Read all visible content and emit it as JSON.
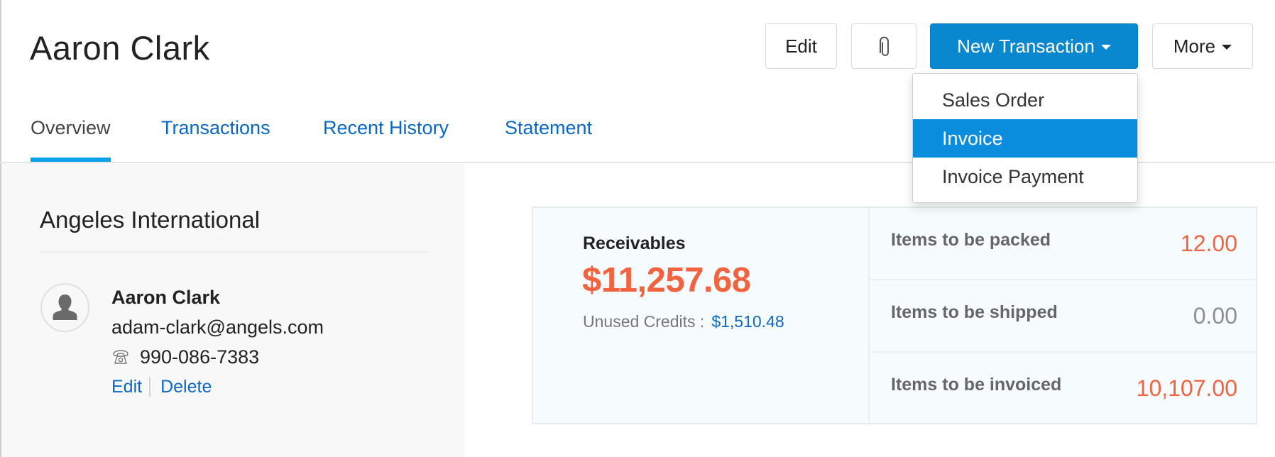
{
  "header": {
    "title": "Aaron Clark",
    "buttons": {
      "edit": "Edit",
      "attach_icon": "paperclip-icon",
      "new_transaction": "New Transaction",
      "more": "More"
    }
  },
  "tabs": [
    {
      "label": "Overview",
      "active": true
    },
    {
      "label": "Transactions",
      "active": false
    },
    {
      "label": "Recent History",
      "active": false
    },
    {
      "label": "Statement",
      "active": false
    }
  ],
  "new_transaction_menu": {
    "items": [
      {
        "label": "Sales Order",
        "highlighted": false
      },
      {
        "label": "Invoice",
        "highlighted": true
      },
      {
        "label": "Invoice Payment",
        "highlighted": false
      }
    ]
  },
  "sidebar": {
    "company": "Angeles International",
    "contact": {
      "avatar_icon": "user-silhouette-icon",
      "name": "Aaron Clark",
      "email": "adam-clark@angels.com",
      "phone_icon": "telephone-icon",
      "phone": "990-086-7383",
      "edit_label": "Edit",
      "delete_label": "Delete"
    }
  },
  "summary": {
    "receivables_label": "Receivables",
    "receivables_amount": "$11,257.68",
    "unused_credits_label": "Unused Credits :",
    "unused_credits_value": "$1,510.48",
    "stats": [
      {
        "label": "Items to be packed",
        "value": "12.00"
      },
      {
        "label": "Items to be shipped",
        "value": "0.00"
      },
      {
        "label": "Items to be invoiced",
        "value": "10,107.00"
      }
    ]
  },
  "colors": {
    "primary": "#0a88cf",
    "link": "#0a68c4",
    "tab_indicator": "#0aa2e8",
    "amount": "#f26340",
    "muted_value": "#8e8e8e",
    "menu_highlight": "#0a8ddd"
  }
}
